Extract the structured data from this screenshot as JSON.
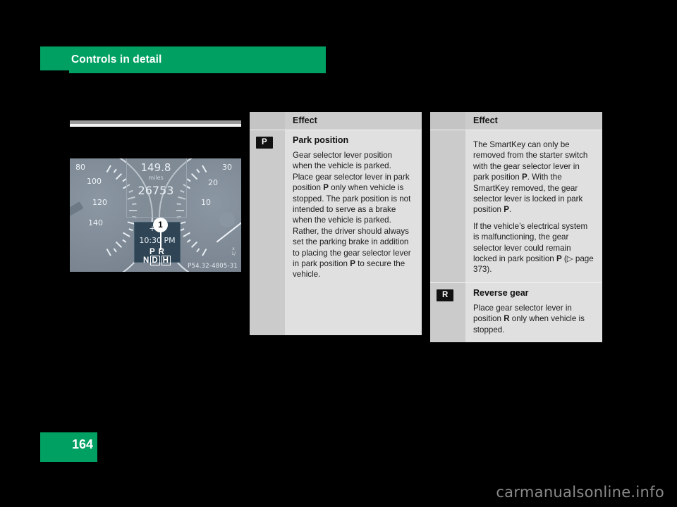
{
  "header": {
    "chapter_title": "Controls in detail",
    "bar_color": "#00a063"
  },
  "figure": {
    "caption_code": "P54.32-4805-31",
    "callout_number": "1",
    "cluster": {
      "trip_distance": "149.8",
      "unit": "miles",
      "odometer": "26753",
      "temperature": "+72",
      "clock": "10:30 PM",
      "gear_letters": "P R N",
      "gear_selected": "D",
      "gear_mode": "H",
      "speedo_ticks": [
        "80",
        "100",
        "120",
        "140"
      ],
      "tach_ticks": [
        "30",
        "20",
        "10"
      ]
    }
  },
  "table_left": {
    "column_header": "Effect",
    "rows": [
      {
        "badge": "P",
        "title": "Park position",
        "paragraphs": [
          "Gear selector lever position when the vehicle is parked. Place gear selector lever in park position <b>P</b> only when vehicle is stopped. The park position is not intended to serve as a brake when the vehicle is parked. Rather, the driver should always set the parking brake in addition to placing the gear selector lever in park position <b>P</b> to secure the vehicle."
        ]
      }
    ]
  },
  "table_right": {
    "column_header": "Effect",
    "rows": [
      {
        "badge": "",
        "title": "",
        "paragraphs": [
          "The SmartKey can only be removed from the starter switch with the gear selector lever in park position <b>P</b>. With the SmartKey removed, the gear selector lever is locked in park position <b>P</b>.",
          "If the vehicle’s electrical system is malfunctioning, the gear selector lever could remain locked in park position <b>P</b> (▷ page 373)."
        ]
      },
      {
        "badge": "R",
        "title": "Reverse gear",
        "paragraphs": [
          "Place gear selector lever in position <b>R</b> only when vehicle is stopped."
        ]
      }
    ]
  },
  "footer": {
    "page_number": "164",
    "watermark": "carmanualsonline.info"
  }
}
